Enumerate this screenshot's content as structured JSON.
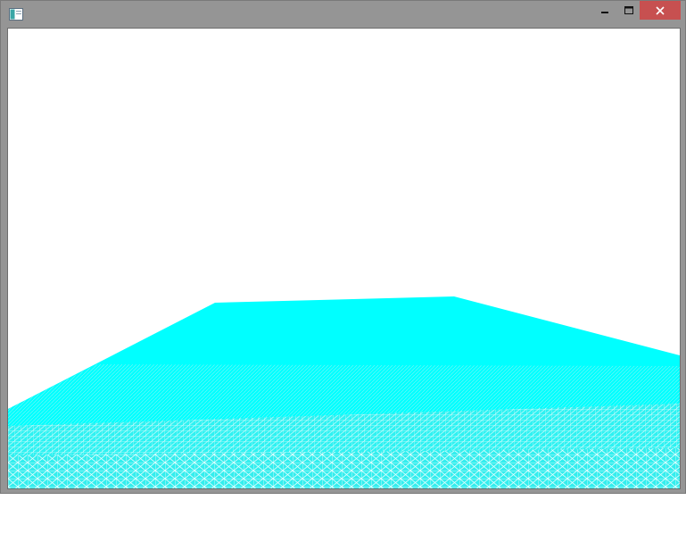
{
  "window": {
    "title": "",
    "buttons": {
      "minimize": "minimize-icon",
      "maximize": "maximize-icon",
      "close": "close-icon"
    },
    "colors": {
      "frame": "#959595",
      "close_button": "#c75050"
    }
  },
  "viewport": {
    "background": "#ffffff",
    "render": "wireframe-terrain",
    "mesh_color": "#00ffff"
  }
}
